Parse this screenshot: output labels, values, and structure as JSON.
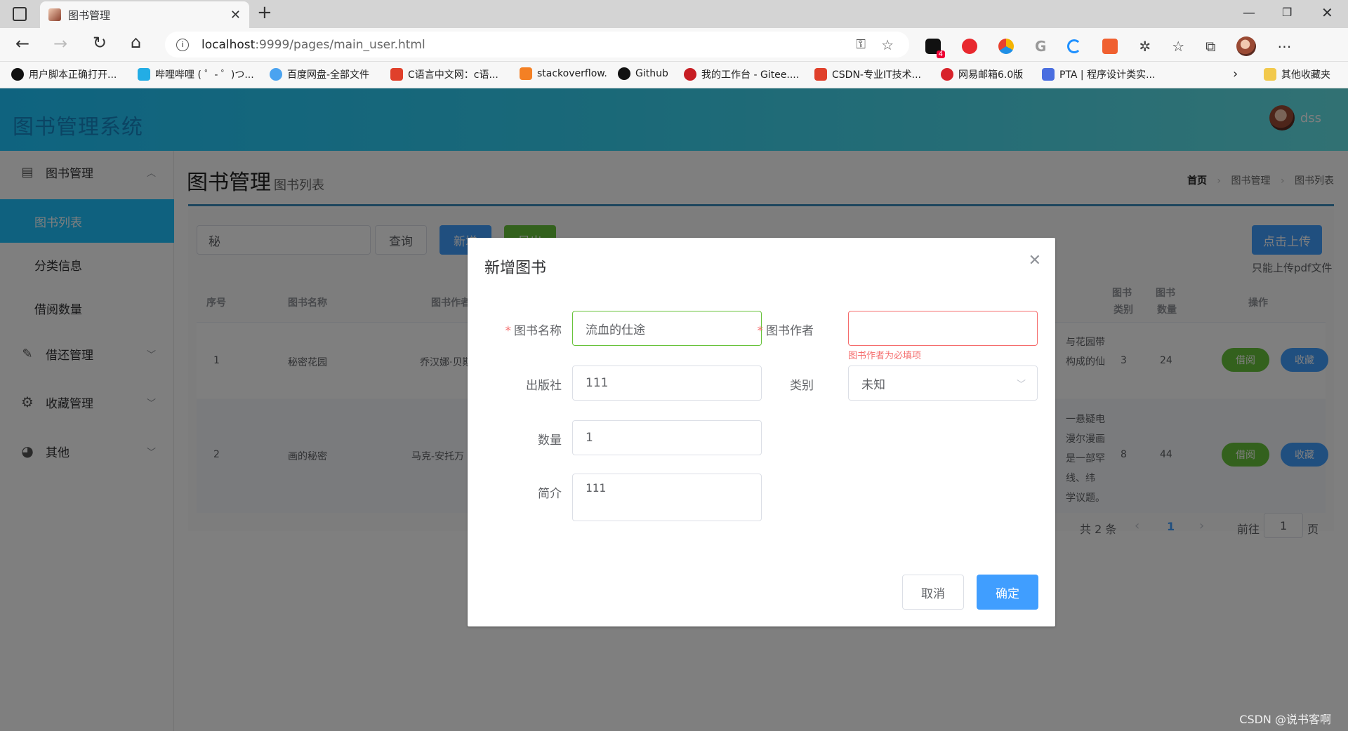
{
  "browser": {
    "tab_title": "图书管理",
    "url_host": "localhost",
    "url_rest": ":9999/pages/main_user.html",
    "ext_badge": "4",
    "bookmarks": [
      "用户脚本正确打开...",
      "哔哩哔哩 ( ゜- ゜)つ...",
      "百度网盘-全部文件",
      "C语言中文网：c语...",
      "stackoverflow.",
      "Github",
      "我的工作台 - Gitee....",
      "CSDN-专业IT技术...",
      "网易邮箱6.0版",
      "PTA | 程序设计类实..."
    ],
    "other_bookmarks": "其他收藏夹"
  },
  "app": {
    "title": "图书管理系统",
    "user": "dss"
  },
  "sidebar": {
    "menus": [
      {
        "label": "图书管理",
        "icon": "book-icon"
      },
      {
        "label": "借还管理",
        "icon": "pencil-icon"
      },
      {
        "label": "收藏管理",
        "icon": "gear-icon"
      },
      {
        "label": "其他",
        "icon": "palette-icon"
      }
    ],
    "sub_items": [
      "图书列表",
      "分类信息",
      "借阅数量"
    ]
  },
  "page": {
    "title": "图书管理",
    "subtitle": "图书列表",
    "breadcrumb": [
      "首页",
      "图书管理",
      "图书列表"
    ],
    "search_value": "秘",
    "query_btn": "查询",
    "new_btn": "新增",
    "export_btn": "导出",
    "upload_btn": "点击上传",
    "upload_tip": "只能上传pdf文件"
  },
  "table": {
    "headers": [
      "序号",
      "图书名称",
      "图书作者",
      "图书",
      "类别",
      "图书",
      "数量",
      "操作"
    ],
    "rows": [
      {
        "no": "1",
        "name": "秘密花园",
        "author": "乔汉娜·贝斯",
        "desc": [
          "与花园带",
          "构成的仙"
        ],
        "category": "3",
        "count": "24"
      },
      {
        "no": "2",
        "name": "画的秘密",
        "author": "马克-安托万",
        "desc": [
          "一悬疑电",
          "漫尔漫画",
          "是一部罕",
          "线、纬",
          "学议题。"
        ],
        "category": "8",
        "count": "44"
      }
    ],
    "borrow_btn": "借阅",
    "fav_btn": "收藏"
  },
  "pagination": {
    "total": "共 2 条",
    "current": "1",
    "goto_label": "前往",
    "goto_value": "1",
    "page_suffix": "页"
  },
  "dialog": {
    "title": "新增图书",
    "name_label": "图书名称",
    "name_value": "流血的仕途",
    "author_label": "图书作者",
    "author_value": "",
    "author_error": "图书作者为必填项",
    "publisher_label": "出版社",
    "publisher_value": "111",
    "category_label": "类别",
    "category_value": "未知",
    "count_label": "数量",
    "count_value": "1",
    "intro_label": "简介",
    "intro_value": "111",
    "cancel_btn": "取消",
    "confirm_btn": "确定"
  },
  "watermark": "CSDN @说书客啊",
  "colors": {
    "primary": "#409eff",
    "success": "#67c23a",
    "danger": "#f56c6c",
    "header_start": "#1ec7ff",
    "header_end": "#63e3e7",
    "active_menu": "#1ec3ff"
  }
}
